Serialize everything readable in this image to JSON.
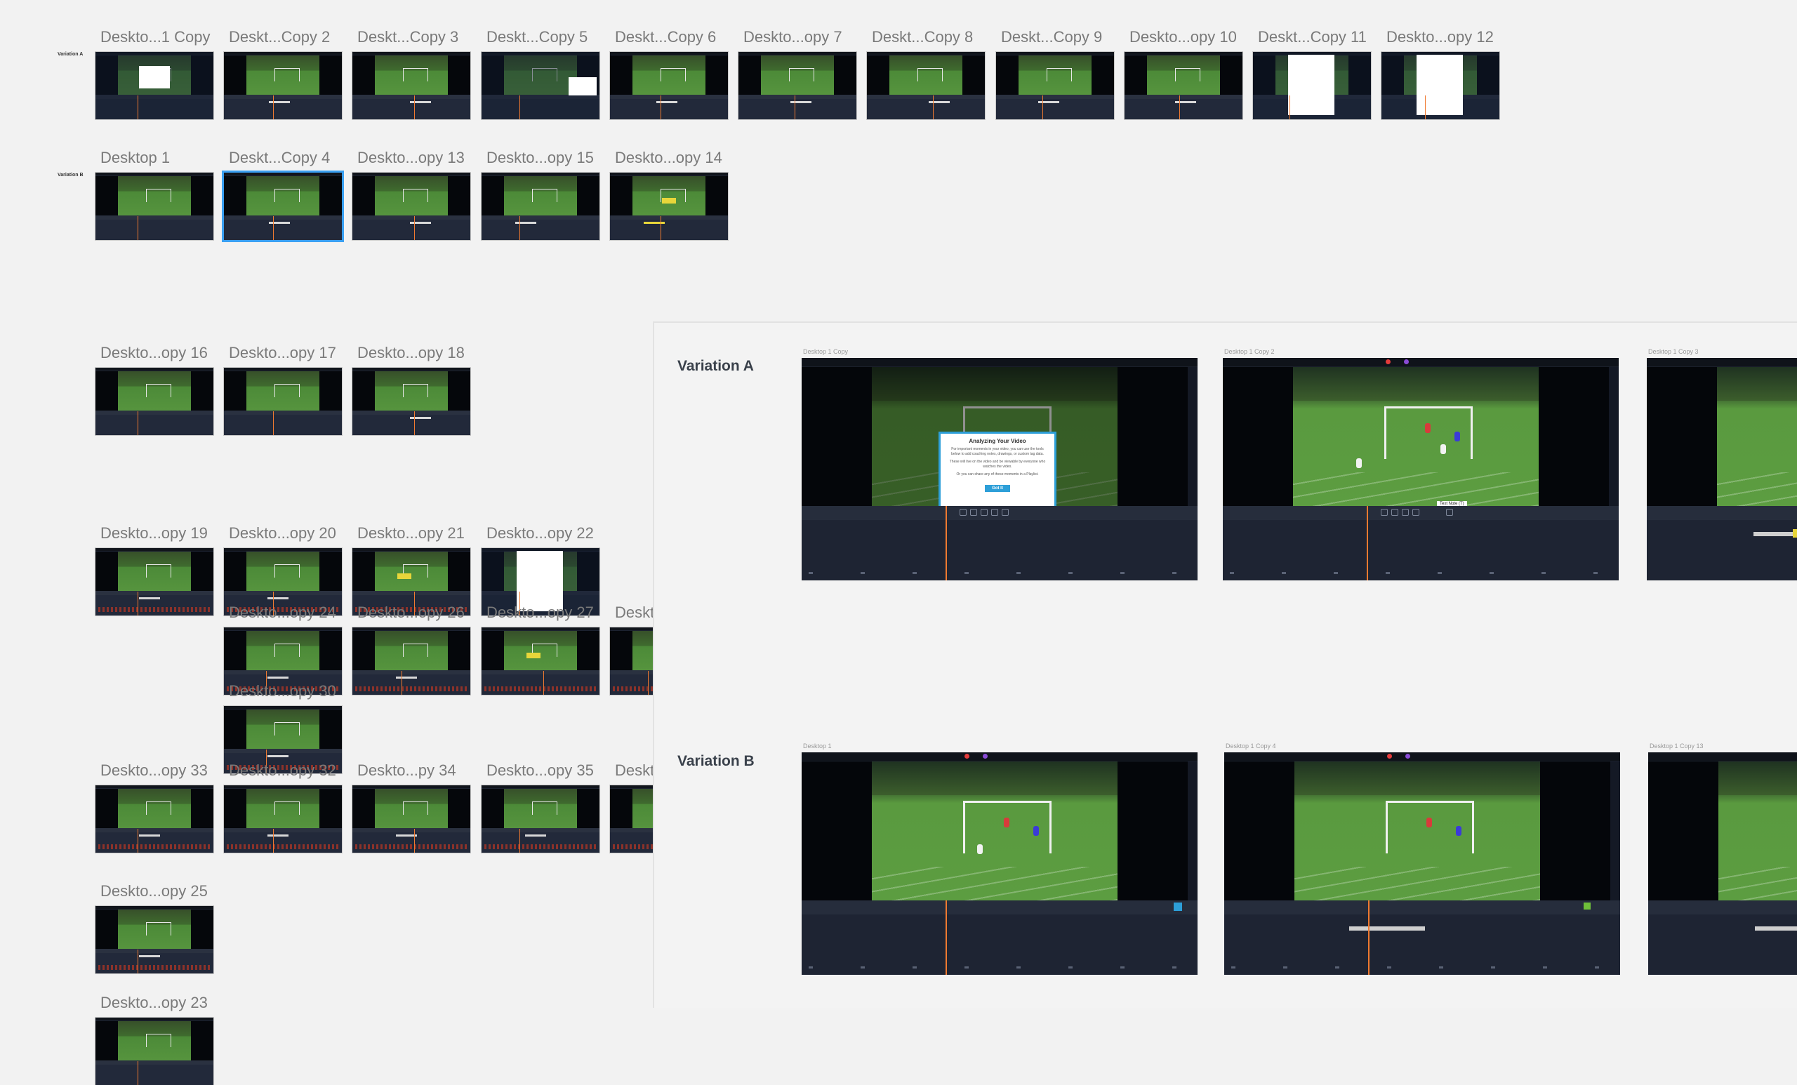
{
  "canvas": {
    "row_variation_a": {
      "label": "Variation A",
      "artboards": [
        "Deskto...1 Copy",
        "Deskt...Copy 2",
        "Deskt...Copy 3",
        "Deskt...Copy 5",
        "Deskt...Copy 6",
        "Deskto...opy 7",
        "Deskt...Copy 8",
        "Deskt...Copy 9",
        "Deskto...opy 10",
        "Deskt...Copy 11",
        "Deskto...opy 12"
      ]
    },
    "row_variation_b": {
      "label": "Variation B",
      "artboards": [
        "Desktop 1",
        "Deskt...Copy 4",
        "Deskto...opy 13",
        "Deskto...opy 15",
        "Deskto...opy 14"
      ]
    },
    "group_3": [
      "Deskto...opy 16",
      "Deskto...opy 17",
      "Deskto...opy 18"
    ],
    "group_4": [
      "Deskto...opy 19",
      "Deskto...opy 20",
      "Deskto...opy 21",
      "Deskto...opy 22"
    ],
    "group_5": [
      "Deskto...opy 24",
      "Deskto...opy 26",
      "Deskto...opy 27",
      "Deskt"
    ],
    "group_6": [
      "Deskto...opy 30"
    ],
    "group_7": [
      "Deskto...opy 33",
      "Deskto...opy 32",
      "Deskto...py 34",
      "Deskto...opy 35",
      "Deskt"
    ],
    "group_8": [
      "Deskto...opy 25"
    ],
    "group_9": [
      "Deskto...opy 23"
    ],
    "selected_artboard": "Deskt...Copy 4"
  },
  "preview": {
    "variation_a": {
      "title": "Variation A",
      "frames": [
        "Desktop 1 Copy",
        "Desktop 1 Copy 2",
        "Desktop 1 Copy 3"
      ]
    },
    "variation_b": {
      "title": "Variation B",
      "frames": [
        "Desktop 1",
        "Desktop 1 Copy 4",
        "Desktop 1 Copy 13"
      ]
    },
    "dialog": {
      "title": "Analyzing Your Video",
      "body_1": "For important moments in your video, you can use the tools below to add coaching notes, drawings, or custom tag data.",
      "body_2": "These will live on the video and be viewable by everyone who watches the video.",
      "body_3": "Or you can share any of these moments in a Playlist.",
      "button": "Got It"
    },
    "tooltip": "Text Note (T)",
    "accent_orange": "#f07a30",
    "accent_blue": "#2d9fd8",
    "selection_blue": "#3aa0f2"
  }
}
